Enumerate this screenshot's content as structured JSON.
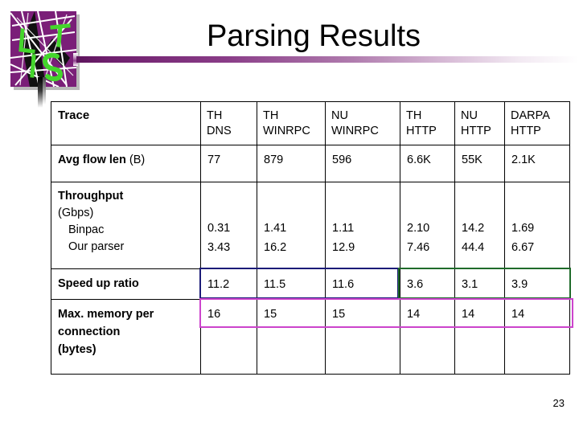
{
  "slide": {
    "title": "Parsing Results",
    "page_number": "23",
    "logo_letters": [
      "L",
      "I",
      "S",
      "T"
    ]
  },
  "colors": {
    "header_fill": "#ffff00",
    "logo_purple": "#7a1f78",
    "logo_green": "#44d62c",
    "title_bar_purple": "#5d155c",
    "highlight_navy": "#1b1b78",
    "highlight_green": "#1f6b2a",
    "highlight_magenta": "#cc44cc"
  },
  "table": {
    "columns": [
      {
        "label_bold": "Trace",
        "line1": "",
        "line2": ""
      },
      {
        "line1": "TH",
        "line2": "DNS"
      },
      {
        "line1": "TH",
        "line2": "WINRPC"
      },
      {
        "line1": "NU",
        "line2": "WINRPC"
      },
      {
        "line1": "TH",
        "line2": "HTTP"
      },
      {
        "line1": "NU",
        "line2": "HTTP"
      },
      {
        "line1": "DARPA",
        "line2": "HTTP"
      }
    ],
    "rows": [
      {
        "label_bold": "Avg flow len",
        "label_normal": " (B)",
        "values": [
          "77",
          "879",
          "596",
          "6.6K",
          "55K",
          "2.1K"
        ]
      },
      {
        "label_bold": "Throughput",
        "label_unit": "(Gbps)",
        "sub_labels": [
          "Binpac",
          "Our parser"
        ],
        "binpac": [
          "0.31",
          "1.41",
          "1.11",
          "2.10",
          "14.2",
          "1.69"
        ],
        "our_parser": [
          "3.43",
          "16.2",
          "12.9",
          "7.46",
          "44.4",
          "6.67"
        ]
      },
      {
        "label_bold": "Speed up ratio",
        "values": [
          "11.2",
          "11.5",
          "11.6",
          "3.6",
          "3.1",
          "3.9"
        ]
      },
      {
        "label_bold": "Max. memory per",
        "label_line2": "connection",
        "label_line3": "(bytes)",
        "values": [
          "16",
          "15",
          "15",
          "14",
          "14",
          "14"
        ]
      }
    ]
  }
}
